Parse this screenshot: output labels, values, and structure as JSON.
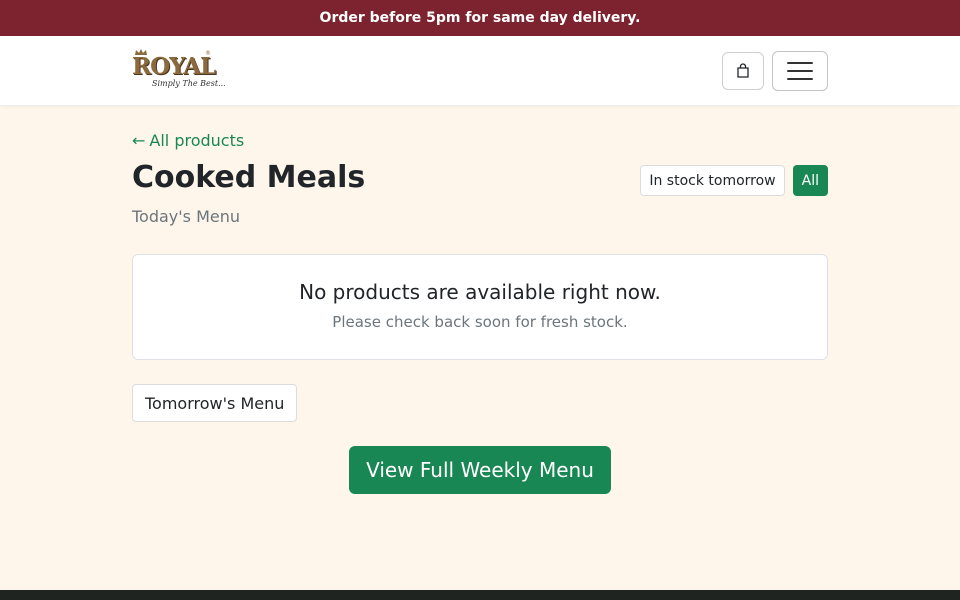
{
  "promo": {
    "text": "Order before 5pm for same day delivery."
  },
  "header": {
    "logo": {
      "brand": "ROYAL",
      "registered": "®",
      "tagline": "Simply The Best..."
    },
    "cart_icon": "shopping-bag-icon",
    "menu_icon": "hamburger-menu-icon"
  },
  "main": {
    "back_link": {
      "arrow": "←",
      "label": "All products"
    },
    "title": "Cooked Meals",
    "subtitle": "Today's Menu",
    "filters": [
      {
        "label": "In stock tomorrow",
        "active": false
      },
      {
        "label": "All",
        "active": true
      }
    ],
    "empty_state": {
      "title": "No products are available right now.",
      "message": "Please check back soon for fresh stock."
    },
    "tomorrow_button": "Tomorrow's Menu",
    "weekly_button": "View Full Weekly Menu"
  },
  "colors": {
    "promo_bg": "#7d2330",
    "accent": "#198754",
    "page_bg": "#fef6ea",
    "footer_bg": "#1f2420"
  }
}
